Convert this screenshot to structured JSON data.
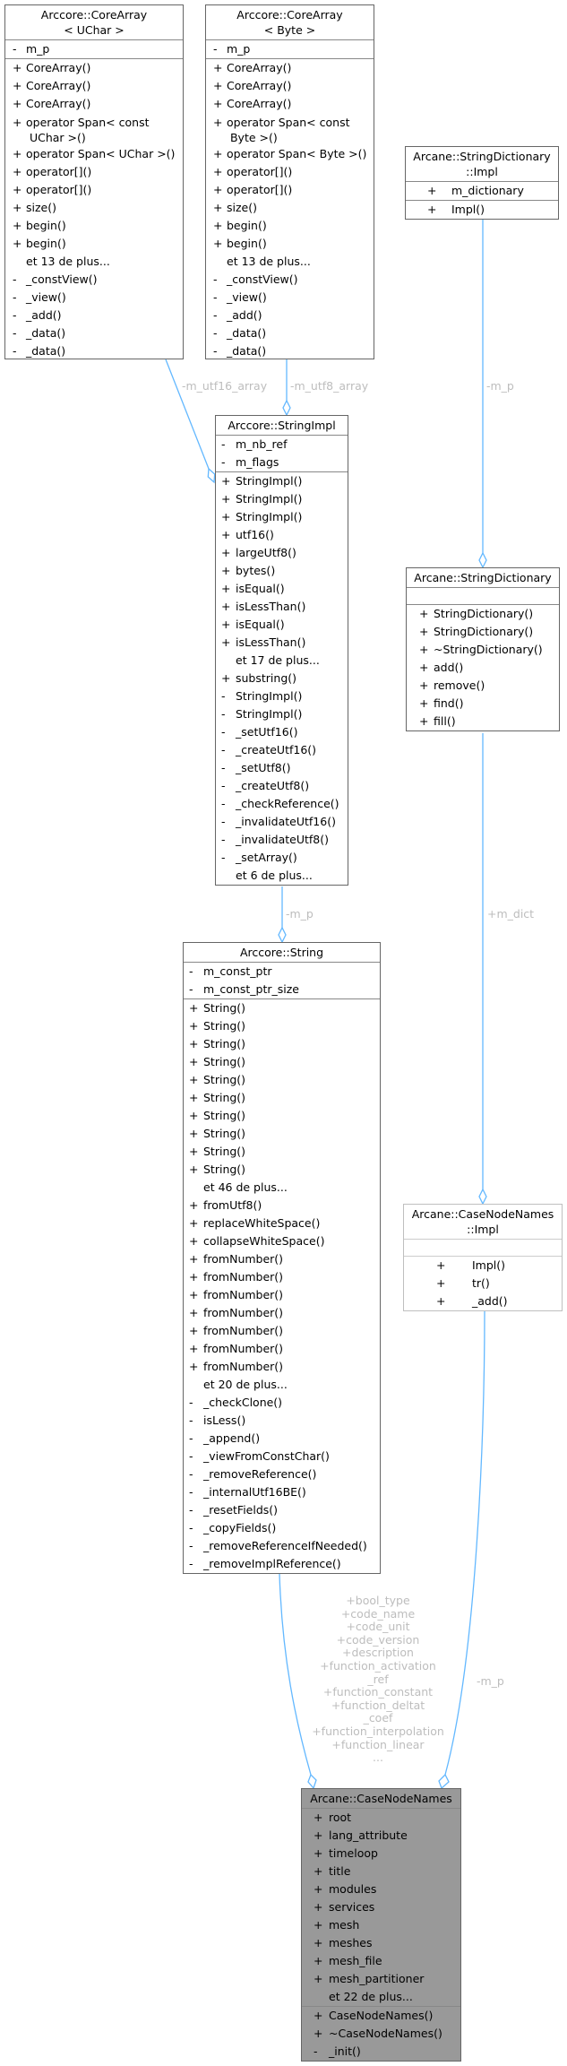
{
  "colors": {
    "edge": "#63b8ff",
    "label": "#bdbdbd",
    "highlight_fill": "#999999",
    "border": "#666666"
  },
  "boxes": [
    {
      "id": "corearray-uchar",
      "title": "Arccore::CoreArray\n< UChar >",
      "attributes": [
        {
          "v": "-",
          "n": "m_p"
        }
      ],
      "methods": [
        {
          "v": "+",
          "n": "CoreArray()"
        },
        {
          "v": "+",
          "n": "CoreArray()"
        },
        {
          "v": "+",
          "n": "CoreArray()"
        },
        {
          "v": "+",
          "n": "operator Span< const\n UChar >()"
        },
        {
          "v": "+",
          "n": "operator Span< UChar >()"
        },
        {
          "v": "+",
          "n": "operator[]()"
        },
        {
          "v": "+",
          "n": "operator[]()"
        },
        {
          "v": "+",
          "n": "size()"
        },
        {
          "v": "+",
          "n": "begin()"
        },
        {
          "v": "+",
          "n": "begin()"
        },
        {
          "v": "",
          "n": "et 13 de plus..."
        },
        {
          "v": "-",
          "n": "_constView()"
        },
        {
          "v": "-",
          "n": "_view()"
        },
        {
          "v": "-",
          "n": "_add()"
        },
        {
          "v": "-",
          "n": "_data()"
        },
        {
          "v": "-",
          "n": "_data()"
        }
      ]
    },
    {
      "id": "corearray-byte",
      "title": "Arccore::CoreArray\n< Byte >",
      "attributes": [
        {
          "v": "-",
          "n": "m_p"
        }
      ],
      "methods": [
        {
          "v": "+",
          "n": "CoreArray()"
        },
        {
          "v": "+",
          "n": "CoreArray()"
        },
        {
          "v": "+",
          "n": "CoreArray()"
        },
        {
          "v": "+",
          "n": "operator Span< const\n Byte >()"
        },
        {
          "v": "+",
          "n": "operator Span< Byte >()"
        },
        {
          "v": "+",
          "n": "operator[]()"
        },
        {
          "v": "+",
          "n": "operator[]()"
        },
        {
          "v": "+",
          "n": "size()"
        },
        {
          "v": "+",
          "n": "begin()"
        },
        {
          "v": "+",
          "n": "begin()"
        },
        {
          "v": "",
          "n": "et 13 de plus..."
        },
        {
          "v": "-",
          "n": "_constView()"
        },
        {
          "v": "-",
          "n": "_view()"
        },
        {
          "v": "-",
          "n": "_add()"
        },
        {
          "v": "-",
          "n": "_data()"
        },
        {
          "v": "-",
          "n": "_data()"
        }
      ]
    },
    {
      "id": "stringdictionary-impl",
      "title": "Arcane::StringDictionary\n::Impl",
      "attributes": [
        {
          "v": "+",
          "n": "m_dictionary"
        }
      ],
      "methods": [
        {
          "v": "+",
          "n": "Impl()"
        }
      ]
    },
    {
      "id": "stringimpl",
      "title": "Arccore::StringImpl",
      "attributes": [
        {
          "v": "-",
          "n": "m_nb_ref"
        },
        {
          "v": "-",
          "n": "m_flags"
        }
      ],
      "methods": [
        {
          "v": "+",
          "n": "StringImpl()"
        },
        {
          "v": "+",
          "n": "StringImpl()"
        },
        {
          "v": "+",
          "n": "StringImpl()"
        },
        {
          "v": "+",
          "n": "utf16()"
        },
        {
          "v": "+",
          "n": "largeUtf8()"
        },
        {
          "v": "+",
          "n": "bytes()"
        },
        {
          "v": "+",
          "n": "isEqual()"
        },
        {
          "v": "+",
          "n": "isLessThan()"
        },
        {
          "v": "+",
          "n": "isEqual()"
        },
        {
          "v": "+",
          "n": "isLessThan()"
        },
        {
          "v": "",
          "n": "et 17 de plus..."
        },
        {
          "v": "+",
          "n": "substring()"
        },
        {
          "v": "-",
          "n": "StringImpl()"
        },
        {
          "v": "-",
          "n": "StringImpl()"
        },
        {
          "v": "-",
          "n": "_setUtf16()"
        },
        {
          "v": "-",
          "n": "_createUtf16()"
        },
        {
          "v": "-",
          "n": "_setUtf8()"
        },
        {
          "v": "-",
          "n": "_createUtf8()"
        },
        {
          "v": "-",
          "n": "_checkReference()"
        },
        {
          "v": "-",
          "n": "_invalidateUtf16()"
        },
        {
          "v": "-",
          "n": "_invalidateUtf8()"
        },
        {
          "v": "-",
          "n": "_setArray()"
        },
        {
          "v": "",
          "n": "et 6 de plus..."
        }
      ]
    },
    {
      "id": "stringdictionary",
      "title": "Arcane::StringDictionary",
      "attributes": [],
      "methods": [
        {
          "v": "+",
          "n": "StringDictionary()"
        },
        {
          "v": "+",
          "n": "StringDictionary()"
        },
        {
          "v": "+",
          "n": "~StringDictionary()"
        },
        {
          "v": "+",
          "n": "add()"
        },
        {
          "v": "+",
          "n": "remove()"
        },
        {
          "v": "+",
          "n": "find()"
        },
        {
          "v": "+",
          "n": "fill()"
        }
      ]
    },
    {
      "id": "string",
      "title": "Arccore::String",
      "attributes": [
        {
          "v": "-",
          "n": "m_const_ptr"
        },
        {
          "v": "-",
          "n": "m_const_ptr_size"
        }
      ],
      "methods": [
        {
          "v": "+",
          "n": "String()"
        },
        {
          "v": "+",
          "n": "String()"
        },
        {
          "v": "+",
          "n": "String()"
        },
        {
          "v": "+",
          "n": "String()"
        },
        {
          "v": "+",
          "n": "String()"
        },
        {
          "v": "+",
          "n": "String()"
        },
        {
          "v": "+",
          "n": "String()"
        },
        {
          "v": "+",
          "n": "String()"
        },
        {
          "v": "+",
          "n": "String()"
        },
        {
          "v": "+",
          "n": "String()"
        },
        {
          "v": "",
          "n": "et 46 de plus..."
        },
        {
          "v": "+",
          "n": "fromUtf8()"
        },
        {
          "v": "+",
          "n": "replaceWhiteSpace()"
        },
        {
          "v": "+",
          "n": "collapseWhiteSpace()"
        },
        {
          "v": "+",
          "n": "fromNumber()"
        },
        {
          "v": "+",
          "n": "fromNumber()"
        },
        {
          "v": "+",
          "n": "fromNumber()"
        },
        {
          "v": "+",
          "n": "fromNumber()"
        },
        {
          "v": "+",
          "n": "fromNumber()"
        },
        {
          "v": "+",
          "n": "fromNumber()"
        },
        {
          "v": "+",
          "n": "fromNumber()"
        },
        {
          "v": "",
          "n": "et 20 de plus..."
        },
        {
          "v": "-",
          "n": "_checkClone()"
        },
        {
          "v": "-",
          "n": "isLess()"
        },
        {
          "v": "-",
          "n": "_append()"
        },
        {
          "v": "-",
          "n": "_viewFromConstChar()"
        },
        {
          "v": "-",
          "n": "_removeReference()"
        },
        {
          "v": "-",
          "n": "_internalUtf16BE()"
        },
        {
          "v": "-",
          "n": "_resetFields()"
        },
        {
          "v": "-",
          "n": "_copyFields()"
        },
        {
          "v": "-",
          "n": "_removeReferenceIfNeeded()"
        },
        {
          "v": "-",
          "n": "_removeImplReference()"
        }
      ]
    },
    {
      "id": "casenodenames-impl",
      "title": "Arcane::CaseNodeNames\n::Impl",
      "attributes": [],
      "methods": [
        {
          "v": "+",
          "n": "Impl()"
        },
        {
          "v": "+",
          "n": "tr()"
        },
        {
          "v": "+",
          "n": "_add()"
        }
      ]
    },
    {
      "id": "casenodenames",
      "title": "Arcane::CaseNodeNames",
      "attributes": [
        {
          "v": "+",
          "n": "root"
        },
        {
          "v": "+",
          "n": "lang_attribute"
        },
        {
          "v": "+",
          "n": "timeloop"
        },
        {
          "v": "+",
          "n": "title"
        },
        {
          "v": "+",
          "n": "modules"
        },
        {
          "v": "+",
          "n": "services"
        },
        {
          "v": "+",
          "n": "mesh"
        },
        {
          "v": "+",
          "n": "meshes"
        },
        {
          "v": "+",
          "n": "mesh_file"
        },
        {
          "v": "+",
          "n": "mesh_partitioner"
        },
        {
          "v": "",
          "n": "et 22 de plus..."
        }
      ],
      "methods": [
        {
          "v": "+",
          "n": "CaseNodeNames()"
        },
        {
          "v": "+",
          "n": "~CaseNodeNames()"
        },
        {
          "v": "-",
          "n": "_init()"
        }
      ]
    }
  ],
  "edge_labels": {
    "utf16": "-m_utf16_array",
    "utf8": "-m_utf8_array",
    "dict_impl": "-m_p",
    "string_impl": "-m_p",
    "dict": "+m_dict",
    "cnn_impl": "-m_p",
    "cnn_strings": [
      "+bool_type",
      "+code_name",
      "+code_unit",
      "+code_version",
      "+description",
      "+function_activation",
      "_ref",
      "+function_constant",
      "+function_deltat",
      "_coef",
      "+function_interpolation",
      "+function_linear",
      "..."
    ]
  }
}
